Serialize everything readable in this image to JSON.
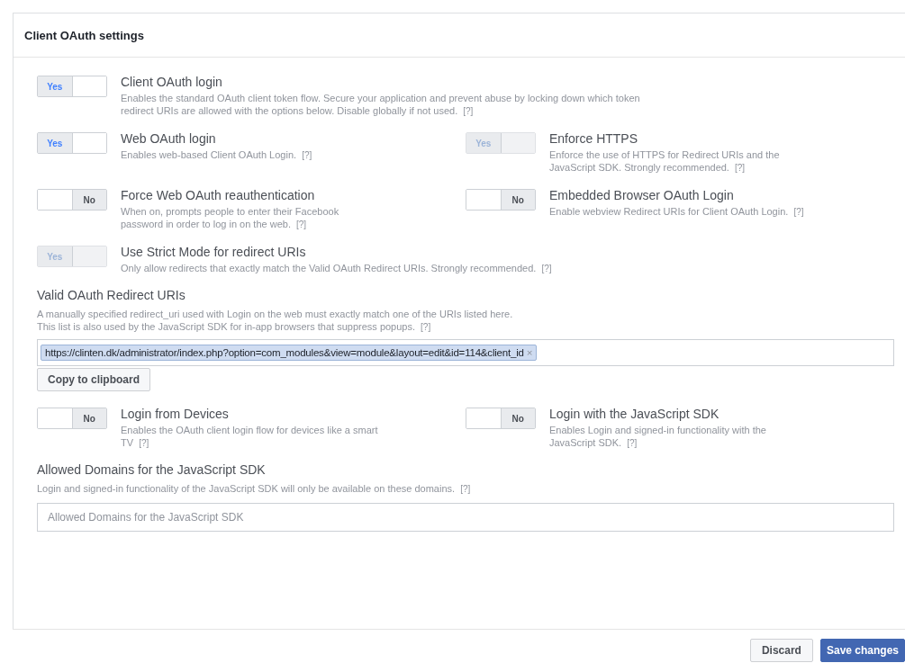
{
  "panel": {
    "title": "Client OAuth settings"
  },
  "rows": [
    {
      "items": [
        {
          "title": "Client OAuth login",
          "description": "Enables the standard OAuth client token flow. Secure your application and prevent abuse by locking down which token redirect URIs are allowed with the options below. Disable globally if not used.",
          "help": "[?]",
          "toggle": {
            "label": "Yes",
            "on": true,
            "disabled": false
          }
        }
      ]
    },
    {
      "items": [
        {
          "title": "Web OAuth login",
          "description": "Enables web-based Client OAuth Login.",
          "help": "[?]",
          "toggle": {
            "label": "Yes",
            "on": true,
            "disabled": false
          }
        },
        {
          "title": "Enforce HTTPS",
          "description": "Enforce the use of HTTPS for Redirect URIs and the JavaScript SDK. Strongly recommended.",
          "help": "[?]",
          "toggle": {
            "label": "Yes",
            "on": true,
            "disabled": true
          }
        }
      ]
    },
    {
      "items": [
        {
          "title": "Force Web OAuth reauthentication",
          "description": "When on, prompts people to enter their Facebook password in order to log in on the web.",
          "help": "[?]",
          "toggle": {
            "label": "No",
            "on": false,
            "disabled": false
          }
        },
        {
          "title": "Embedded Browser OAuth Login",
          "description": "Enable webview Redirect URIs for Client OAuth Login.",
          "help": "[?]",
          "toggle": {
            "label": "No",
            "on": false,
            "disabled": false
          }
        }
      ]
    },
    {
      "items": [
        {
          "title": "Use Strict Mode for redirect URIs",
          "description": "Only allow redirects that exactly match the Valid OAuth Redirect URIs. Strongly recommended.",
          "help": "[?]",
          "toggle": {
            "label": "Yes",
            "on": true,
            "disabled": true
          }
        }
      ]
    }
  ],
  "redirect_uris": {
    "label": "Valid OAuth Redirect URIs",
    "description": "A manually specified redirect_uri used with Login on the web must exactly match one of the URIs listed here.\nThis list is also used by the JavaScript SDK for in-app browsers that suppress popups.",
    "help": "[?]",
    "tags": [
      "https://clinten.dk/administrator/index.php?option=com_modules&view=module&layout=edit&id=114&client_id"
    ],
    "remove": "×",
    "copy_button": "Copy to clipboard"
  },
  "rows2": [
    {
      "items": [
        {
          "title": "Login from Devices",
          "description": "Enables the OAuth client login flow for devices like a smart TV",
          "help": "[?]",
          "toggle": {
            "label": "No",
            "on": false,
            "disabled": false
          }
        },
        {
          "title": "Login with the JavaScript SDK",
          "description": "Enables Login and signed-in functionality with the JavaScript SDK.",
          "help": "[?]",
          "toggle": {
            "label": "No",
            "on": false,
            "disabled": false
          }
        }
      ]
    }
  ],
  "allowed_domains": {
    "label": "Allowed Domains for the JavaScript SDK",
    "description": "Login and signed-in functionality of the JavaScript SDK will only be available on these domains.",
    "help": "[?]",
    "placeholder": "Allowed Domains for the JavaScript SDK"
  },
  "footer": {
    "discard": "Discard",
    "save": "Save changes"
  }
}
